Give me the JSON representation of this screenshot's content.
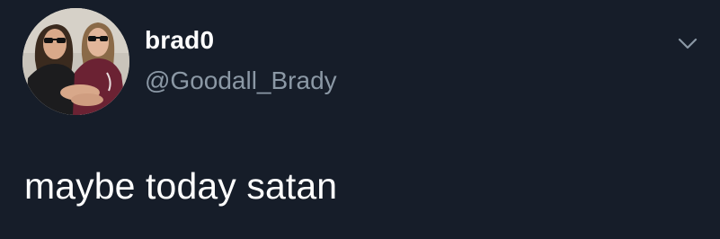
{
  "tweet": {
    "author": {
      "display_name": "brad0",
      "handle": "@Goodall_Brady",
      "avatar_icon": "profile-photo-two-people"
    },
    "text": "maybe today satan",
    "menu_icon": "chevron-down-icon"
  },
  "colors": {
    "background": "#161d29",
    "primary_text": "#ffffff",
    "secondary_text": "#8b98a5"
  }
}
